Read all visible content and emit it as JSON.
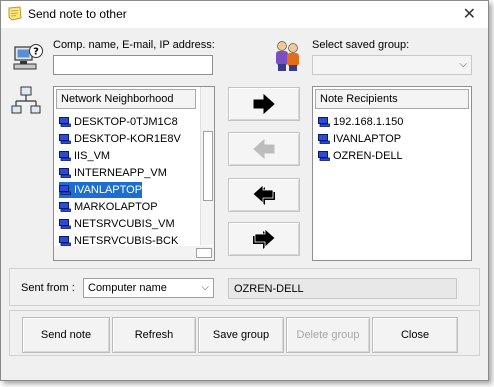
{
  "window": {
    "title": "Send note to other",
    "close_glyph": "✕"
  },
  "address": {
    "label": "Comp. name, E-mail, IP address:",
    "value": ""
  },
  "saved_group": {
    "label": "Select saved group:",
    "value": ""
  },
  "network": {
    "header": "Network Neighborhood",
    "items": [
      {
        "label": "DESKTOP-0TJM1C8",
        "selected": false
      },
      {
        "label": "DESKTOP-KOR1E8V",
        "selected": false
      },
      {
        "label": "IIS_VM",
        "selected": false
      },
      {
        "label": "INTERNEAPP_VM",
        "selected": false
      },
      {
        "label": "IVANLAPTOP",
        "selected": true
      },
      {
        "label": "MARKOLAPTOP",
        "selected": false
      },
      {
        "label": "NETSRVCUBIS_VM",
        "selected": false
      },
      {
        "label": "NETSRVCUBIS-BCK",
        "selected": false
      }
    ]
  },
  "recipients": {
    "header": "Note Recipients",
    "items": [
      "192.168.1.150",
      "IVANLAPTOP",
      "OZREN-DELL"
    ]
  },
  "transfer_buttons": [
    {
      "name": "add-recipient",
      "icon": "right-arrow-icon",
      "enabled": true
    },
    {
      "name": "remove-recipient",
      "icon": "left-arrow-icon",
      "enabled": false
    },
    {
      "name": "remove-all-recipients",
      "icon": "double-left-arrow-icon",
      "enabled": true
    },
    {
      "name": "add-all-recipients",
      "icon": "double-right-arrow-icon",
      "enabled": true
    }
  ],
  "sent_from": {
    "label": "Sent from :",
    "selected": "Computer name",
    "value": "OZREN-DELL"
  },
  "buttons": {
    "send_note": "Send note",
    "refresh": "Refresh",
    "save_group": "Save group",
    "delete_group": "Delete group",
    "close": "Close"
  },
  "colors": {
    "selection": "#1c6fd1",
    "arrow": "#000000",
    "disabled": "#a6a6a6"
  }
}
